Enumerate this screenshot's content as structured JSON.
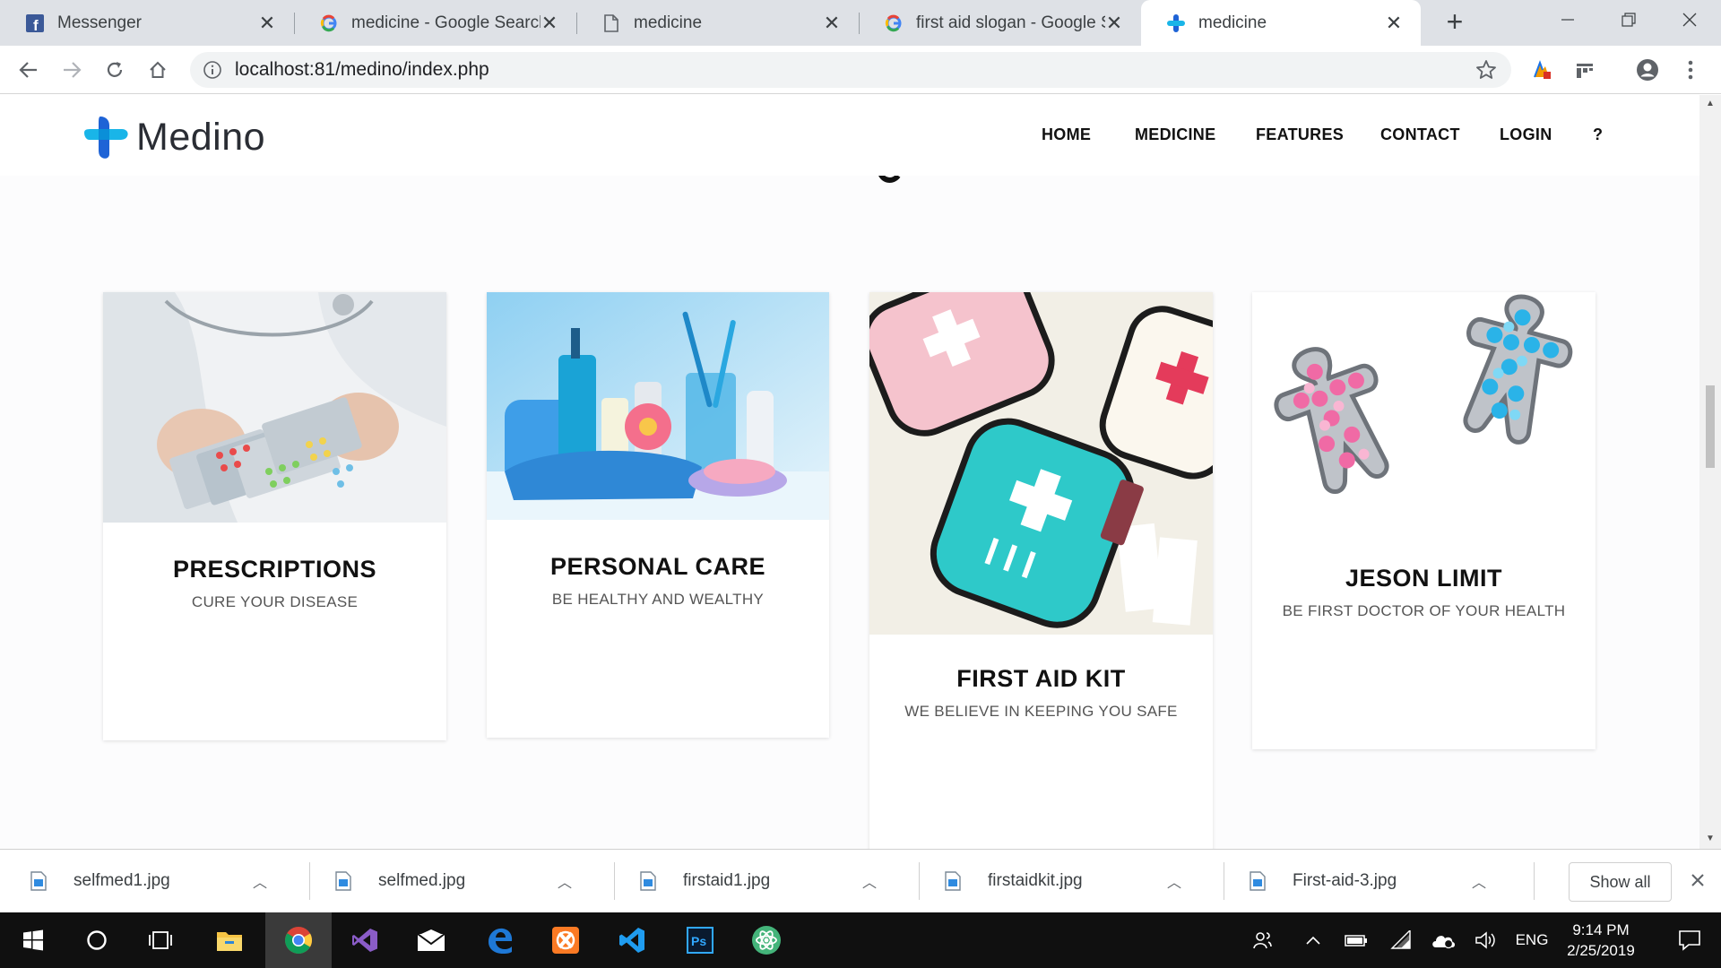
{
  "browser": {
    "tabs": [
      {
        "title": "Messenger",
        "icon": "facebook-icon",
        "active": false
      },
      {
        "title": "medicine - Google Search",
        "icon": "google-icon",
        "active": false
      },
      {
        "title": "medicine",
        "icon": "page-icon",
        "active": false
      },
      {
        "title": "first aid slogan - Google Se",
        "icon": "google-icon",
        "active": false
      },
      {
        "title": "medicine",
        "icon": "medino-icon",
        "active": true
      }
    ],
    "url": "localhost:81/medino/index.php"
  },
  "site": {
    "brand": "Medino",
    "nav": [
      "HOME",
      "MEDICINE",
      "FEATURES",
      "CONTACT",
      "LOGIN",
      "?"
    ],
    "cards": [
      {
        "title": "PRESCRIPTIONS",
        "subtitle": "CURE YOUR DISEASE"
      },
      {
        "title": "PERSONAL CARE",
        "subtitle": "BE HEALTHY AND WEALTHY"
      },
      {
        "title": "FIRST AID KIT",
        "subtitle": "WE BELIEVE IN KEEPING YOU SAFE"
      },
      {
        "title": "JESON LIMIT",
        "subtitle": "BE FIRST DOCTOR OF YOUR HEALTH"
      }
    ]
  },
  "downloads": {
    "files": [
      "selfmed1.jpg",
      "selfmed.jpg",
      "firstaid1.jpg",
      "firstaidkit.jpg",
      "First-aid-3.jpg"
    ],
    "show_all": "Show all"
  },
  "taskbar": {
    "apps": [
      "windows-start-icon",
      "cortana-icon",
      "task-view-icon",
      "file-explorer-icon",
      "chrome-icon",
      "visual-studio-icon",
      "mail-icon",
      "edge-icon",
      "xampp-icon",
      "vscode-icon",
      "photoshop-icon",
      "atom-icon"
    ],
    "language": "ENG",
    "time": "9:14 PM",
    "date": "2/25/2019"
  },
  "colors": {
    "accent_blue": "#1a73e8",
    "logo_cyan": "#19b5e8",
    "logo_blue": "#1e63d6",
    "teal_kit": "#2ec9c9",
    "pink": "#f2b8c6"
  }
}
